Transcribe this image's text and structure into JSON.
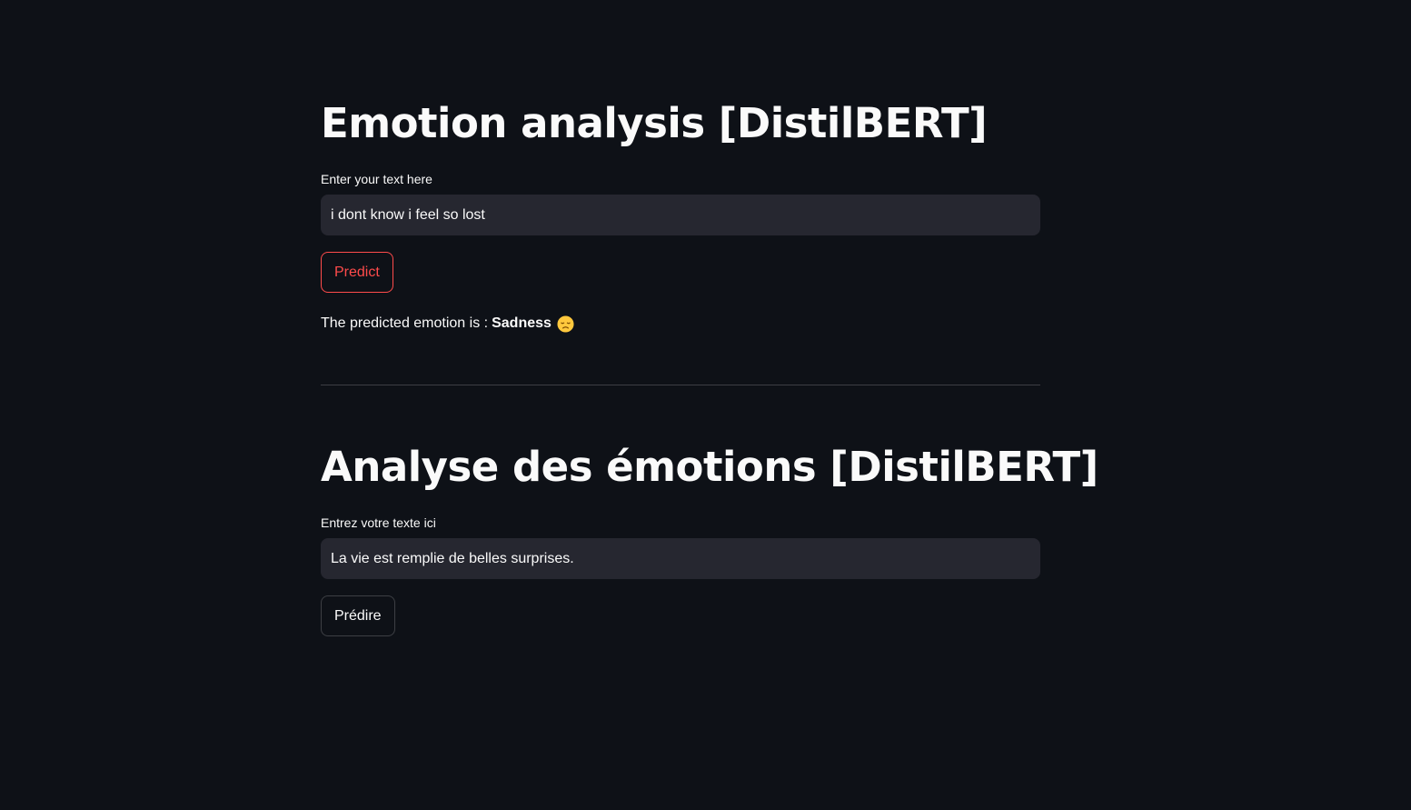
{
  "english": {
    "title": "Emotion analysis [DistilBERT]",
    "input_label": "Enter your text here",
    "input_value": "i dont know i feel so lost",
    "button_label": "Predict",
    "result_prefix": "The predicted emotion is :",
    "result_emotion": "Sadness",
    "result_icon": "disappointed-face-icon"
  },
  "french": {
    "title": "Analyse des émotions [DistilBERT]",
    "input_label": "Entrez votre texte ici",
    "input_value": "La vie est remplie de belles surprises.",
    "button_label": "Prédire"
  },
  "colors": {
    "background": "#0e1117",
    "input_background": "#262730",
    "accent": "#ff4b4b",
    "text": "#fafafa"
  }
}
